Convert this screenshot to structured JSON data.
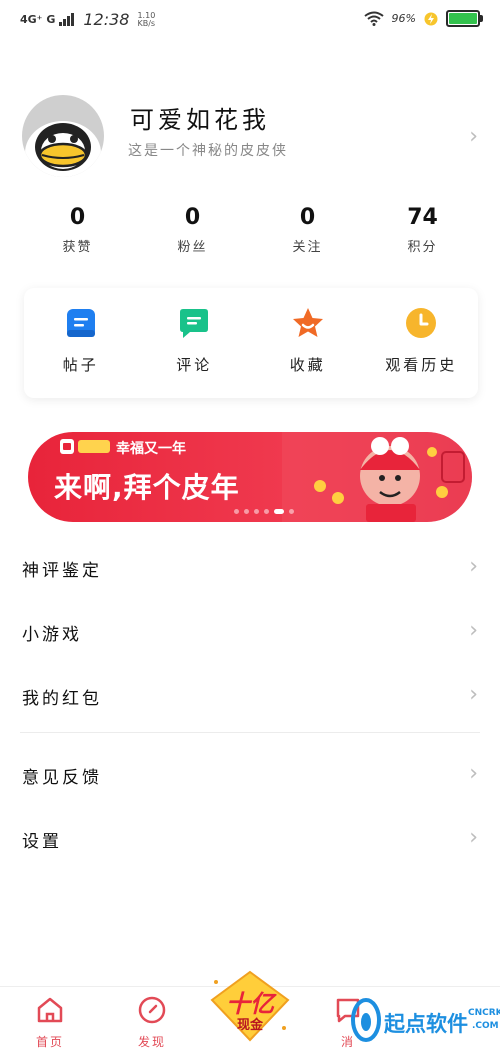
{
  "status_bar": {
    "network": "4G⁺ G",
    "time": "12:38",
    "speed_value": "1.10",
    "speed_unit": "KB/s",
    "battery_pct": "96%"
  },
  "profile": {
    "username": "可爱如花我",
    "bio": "这是一个神秘的皮皮侠"
  },
  "stats": [
    {
      "value": "0",
      "label": "获赞"
    },
    {
      "value": "0",
      "label": "粉丝"
    },
    {
      "value": "0",
      "label": "关注"
    },
    {
      "value": "74",
      "label": "积分"
    }
  ],
  "quick_actions": [
    {
      "label": "帖子",
      "icon": "post-icon",
      "color": "#1f7ff0"
    },
    {
      "label": "评论",
      "icon": "comment-icon",
      "color": "#19c28a"
    },
    {
      "label": "收藏",
      "icon": "favorite-star-icon",
      "color": "#f06a26"
    },
    {
      "label": "观看历史",
      "icon": "history-clock-icon",
      "color": "#f7b52c"
    }
  ],
  "banner": {
    "subtitle": "幸福又一年",
    "title": "来啊,拜个皮年"
  },
  "menu": [
    {
      "label": "神评鉴定"
    },
    {
      "label": "小游戏"
    },
    {
      "label": "我的红包"
    },
    {
      "label": "意见反馈"
    },
    {
      "label": "设置"
    }
  ],
  "tabbar": [
    {
      "label": "首页",
      "icon": "home-icon"
    },
    {
      "label": "发现",
      "icon": "compass-icon"
    },
    {
      "label": "消",
      "icon": "message-icon"
    }
  ],
  "reward": {
    "line1": "十亿",
    "line2": "现金"
  },
  "watermark": {
    "text": "起点软件",
    "domain": "CNCRK",
    "tld": ".COM"
  },
  "colors": {
    "accent": "#e24a56",
    "battery": "#33c24d",
    "banner": "#e8243a"
  }
}
